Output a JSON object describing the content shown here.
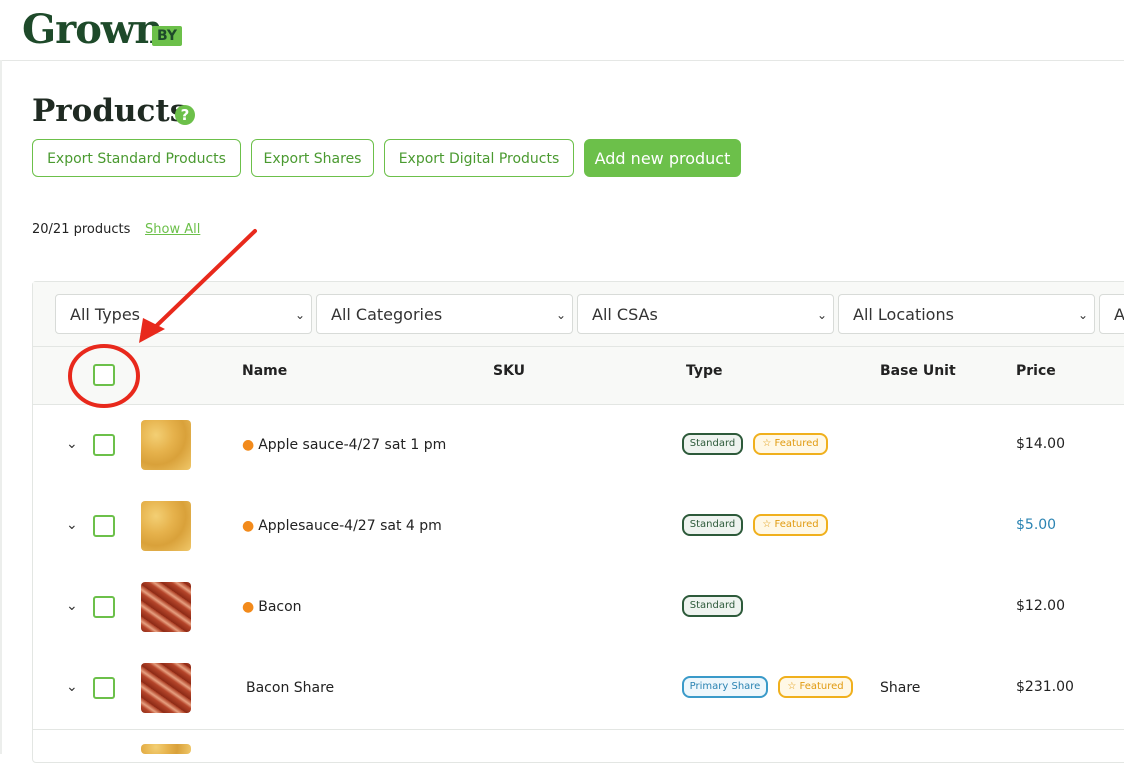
{
  "brand": {
    "name": "Grown",
    "suffix": "BY"
  },
  "page": {
    "title": "Products",
    "help_icon": "?"
  },
  "actions": {
    "export_standard": "Export Standard Products",
    "export_shares": "Export Shares",
    "export_digital": "Export Digital Products",
    "add_new": "Add new product"
  },
  "summary": {
    "count": "20/21 products",
    "show_all": "Show All"
  },
  "filters": {
    "types": "All Types",
    "categories": "All Categories",
    "csas": "All CSAs",
    "locations": "All Locations",
    "more": "A"
  },
  "columns": {
    "name": "Name",
    "sku": "SKU",
    "type": "Type",
    "base_unit": "Base Unit",
    "price": "Price"
  },
  "rows": [
    {
      "name": "Apple sauce-4/27 sat 1 pm",
      "type": "Standard",
      "featured": "Featured",
      "base_unit": "",
      "price": "$14.00"
    },
    {
      "name": "Applesauce-4/27 sat 4 pm",
      "type": "Standard",
      "featured": "Featured",
      "base_unit": "",
      "price": "$5.00"
    },
    {
      "name": "Bacon",
      "type": "Standard",
      "featured": "",
      "base_unit": "",
      "price": "$12.00"
    },
    {
      "name": "Bacon Share",
      "type": "Primary Share",
      "featured": "Featured",
      "base_unit": "Share",
      "price": "$231.00"
    }
  ],
  "colors": {
    "accent": "#6cc04a",
    "brand_dark": "#1e4a2a",
    "annotation": "#e8291c",
    "link_price": "#2a83b2"
  }
}
